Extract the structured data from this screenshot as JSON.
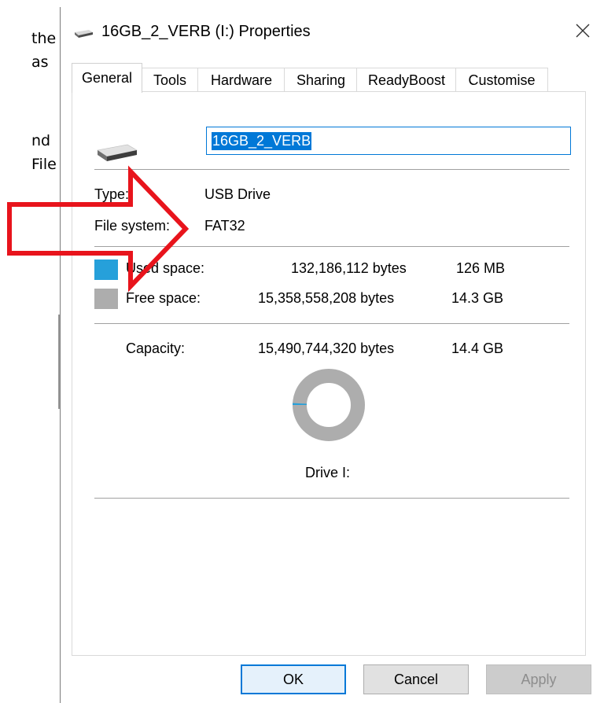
{
  "background_text": {
    "line1": "the",
    "line2": "as",
    "line3": "nd",
    "line4": "File"
  },
  "window": {
    "title": "16GB_2_VERB (I:) Properties",
    "close_glyph": "✕"
  },
  "tabs": [
    {
      "label": "General",
      "active": true
    },
    {
      "label": "Tools"
    },
    {
      "label": "Hardware"
    },
    {
      "label": "Sharing"
    },
    {
      "label": "ReadyBoost"
    },
    {
      "label": "Customise"
    }
  ],
  "general": {
    "drive_name": "16GB_2_VERB",
    "type_label": "Type:",
    "type_value": "USB Drive",
    "fs_label": "File system:",
    "fs_value": "FAT32",
    "used_label": "Used space:",
    "used_bytes": "132,186,112 bytes",
    "used_size": "126 MB",
    "free_label": "Free space:",
    "free_bytes": "15,358,558,208 bytes",
    "free_size": "14.3 GB",
    "capacity_label": "Capacity:",
    "capacity_bytes": "15,490,744,320 bytes",
    "capacity_size": "14.4 GB",
    "drive_letter_label": "Drive I:",
    "used_fraction": 0.0085
  },
  "buttons": {
    "ok": "OK",
    "cancel": "Cancel",
    "apply": "Apply"
  },
  "colors": {
    "used": "#26a0da",
    "free": "#adadad",
    "accent": "#0078d7",
    "annotation": "#e8141c"
  },
  "icons": {
    "drive": "usb-drive-icon",
    "close": "close-icon"
  }
}
